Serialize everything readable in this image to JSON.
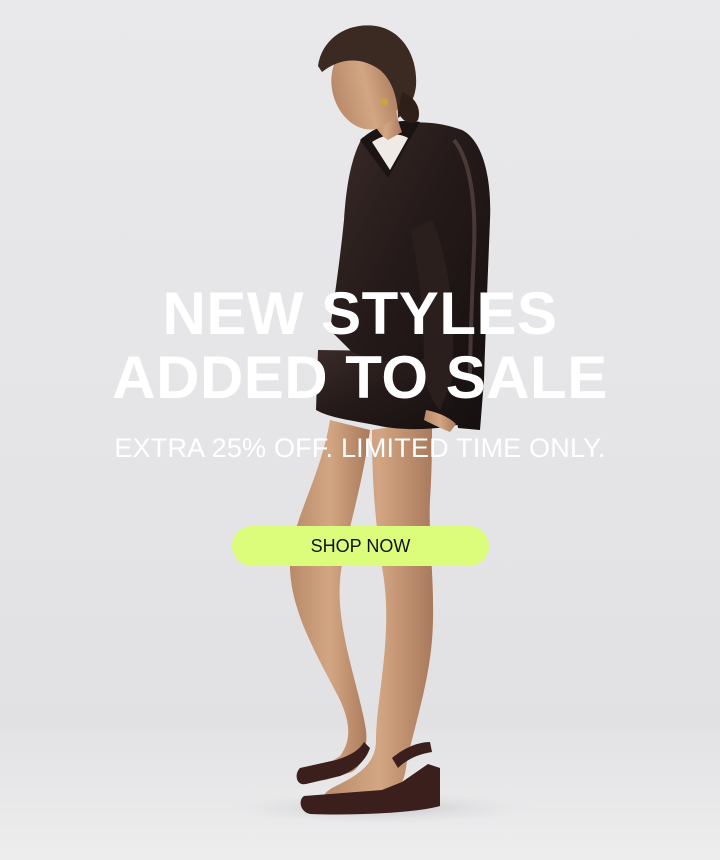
{
  "hero": {
    "headline_line1": "NEW STYLES",
    "headline_line2": "ADDED TO SALE",
    "subheadline": "EXTRA 25% OFF. LIMITED TIME ONLY.",
    "cta_label": "SHOP NOW"
  },
  "colors": {
    "background": "#e6e6e8",
    "text": "#ffffff",
    "cta_background": "#dcfd7c",
    "cta_text": "#111111"
  },
  "image": {
    "subject": "model-in-leather-jacket-icon"
  }
}
